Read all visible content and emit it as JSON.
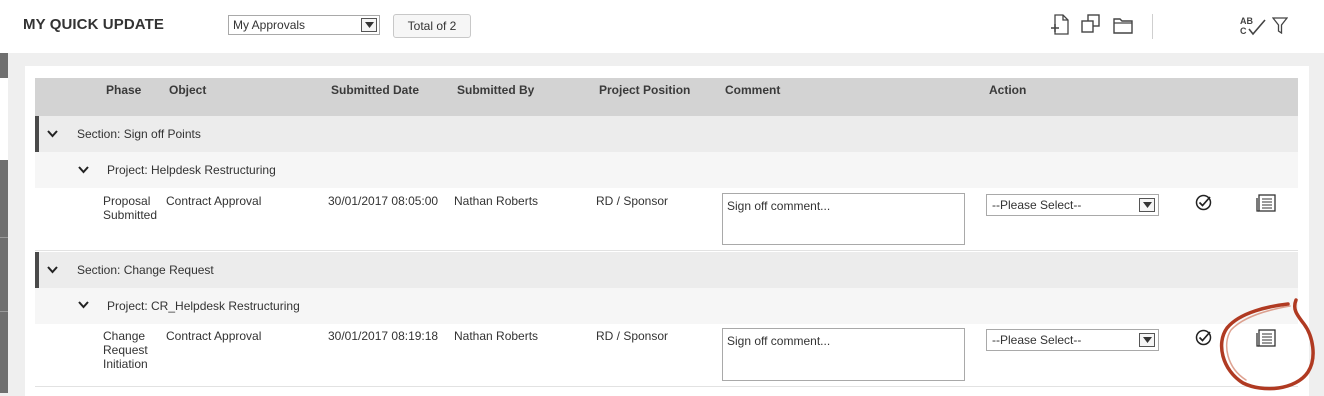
{
  "header": {
    "title": "MY QUICK UPDATE",
    "view_select_value": "My Approvals",
    "total_label": "Total of 2"
  },
  "toolbar_icons": [
    "add-document-icon",
    "copy-icon",
    "folder-icon",
    "spell-check-icon",
    "filter-icon"
  ],
  "spellcheck_glyph": "ABC",
  "table": {
    "columns": [
      "Phase",
      "Object",
      "Submitted Date",
      "Submitted By",
      "Project Position",
      "Comment",
      "Action"
    ],
    "sections": [
      {
        "label": "Section: Sign off Points",
        "project": "Project: Helpdesk Restructuring",
        "row": {
          "phase": [
            "Proposal",
            "Submitted"
          ],
          "object": "Contract Approval",
          "submitted_date": "30/01/2017 08:05:00",
          "submitted_by": "Nathan Roberts",
          "project_position": "RD / Sponsor",
          "comment_placeholder": "Sign off comment...",
          "action_value": "--Please Select--"
        }
      },
      {
        "label": "Section: Change Request",
        "project": "Project: CR_Helpdesk Restructuring",
        "row": {
          "phase": [
            "Change",
            "Request",
            "Initiation"
          ],
          "object": "Contract Approval",
          "submitted_date": "30/01/2017 08:19:18",
          "submitted_by": "Nathan Roberts",
          "project_position": "RD / Sponsor",
          "comment_placeholder": "Sign off comment...",
          "action_value": "--Please Select--"
        }
      }
    ]
  },
  "colors": {
    "header_bg": "#d3d3d3",
    "section_bg": "#ececec",
    "annotation_ring": "#b03a22"
  }
}
